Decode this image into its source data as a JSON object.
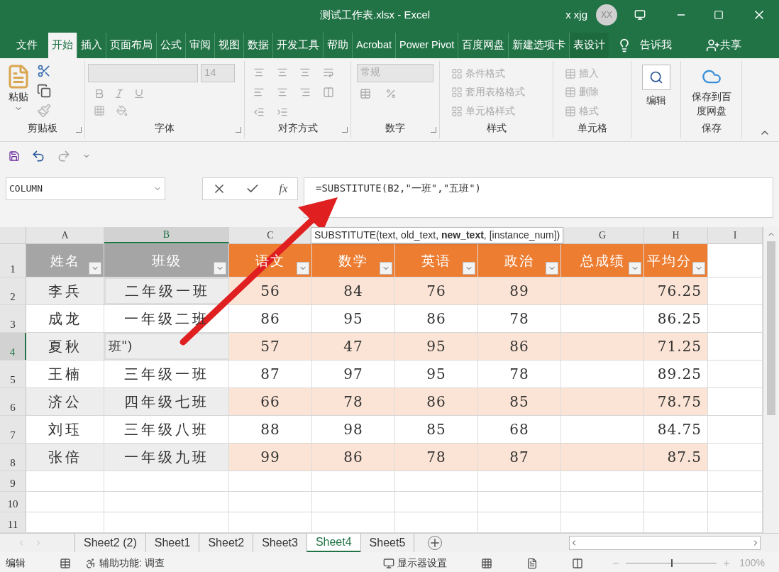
{
  "window": {
    "title": "测试工作表.xlsx  -  Excel",
    "user": "x xjg",
    "avatar": "XX"
  },
  "tabs": [
    {
      "label": "文件",
      "selected": false
    },
    {
      "label": "开始",
      "selected": true
    },
    {
      "label": "插入",
      "selected": false
    },
    {
      "label": "页面布局",
      "selected": false
    },
    {
      "label": "公式",
      "selected": false
    },
    {
      "label": "审阅",
      "selected": false
    },
    {
      "label": "视图",
      "selected": false
    },
    {
      "label": "数据",
      "selected": false
    },
    {
      "label": "开发工具",
      "selected": false
    },
    {
      "label": "帮助",
      "selected": false
    },
    {
      "label": "Acrobat",
      "selected": false
    },
    {
      "label": "Power Pivot",
      "selected": false
    },
    {
      "label": "百度网盘",
      "selected": false
    },
    {
      "label": "新建选项卡",
      "selected": false
    },
    {
      "label": "表设计",
      "selected": false
    }
  ],
  "tell_me": "告诉我",
  "share": "共享",
  "ribbon": {
    "clipboard": {
      "label": "剪贴板",
      "paste": "粘贴"
    },
    "font": {
      "label": "字体",
      "size": "14"
    },
    "alignment": {
      "label": "对齐方式"
    },
    "number": {
      "label": "数字",
      "format": "常规"
    },
    "styles": {
      "label": "样式",
      "items": [
        {
          "label": "条件格式",
          "disabled": true
        },
        {
          "label": "套用表格格式",
          "disabled": true
        },
        {
          "label": "单元格样式",
          "disabled": true
        }
      ]
    },
    "cells": {
      "label": "单元格",
      "items": [
        {
          "label": "插入",
          "disabled": true
        },
        {
          "label": "删除",
          "disabled": true
        },
        {
          "label": "格式",
          "disabled": true
        }
      ]
    },
    "editing": {
      "label": "编辑"
    },
    "save": {
      "button": "保存到百度网盘",
      "label": "保存"
    }
  },
  "name_box": "COLUMN",
  "formula": "=SUBSTITUTE(B2,\"一班\",\"五班\")",
  "tooltip": "SUBSTITUTE(text, old_text, **new_text**, [instance_num])",
  "function_button": "fx",
  "columns": [
    {
      "label": "A",
      "selected": false
    },
    {
      "label": "B",
      "selected": true
    },
    {
      "label": "C",
      "selected": false
    },
    {
      "label": "G",
      "selected": false
    },
    {
      "label": "H",
      "selected": false
    },
    {
      "label": "I",
      "selected": false
    }
  ],
  "table_headers": [
    "姓名",
    "班级",
    "语文",
    "数学",
    "英语",
    "政治",
    "总成绩",
    "平均分"
  ],
  "rows": [
    {
      "num": "1",
      "selected": false,
      "cells": []
    },
    {
      "num": "2",
      "selected": false,
      "cells": [
        "李兵",
        "二年级一班",
        "56",
        "84",
        "76",
        "89",
        "",
        "76.25"
      ]
    },
    {
      "num": "3",
      "selected": false,
      "cells": [
        "成龙",
        "一年级二班",
        "86",
        "95",
        "86",
        "78",
        "",
        "86.25"
      ]
    },
    {
      "num": "4",
      "selected": true,
      "cells": [
        "夏秋",
        "班\")",
        "57",
        "47",
        "95",
        "86",
        "",
        "71.25"
      ]
    },
    {
      "num": "5",
      "selected": false,
      "cells": [
        "王楠",
        "三年级一班",
        "87",
        "97",
        "95",
        "78",
        "",
        "89.25"
      ]
    },
    {
      "num": "6",
      "selected": false,
      "cells": [
        "济公",
        "四年级七班",
        "66",
        "78",
        "86",
        "85",
        "",
        "78.75"
      ]
    },
    {
      "num": "7",
      "selected": false,
      "cells": [
        "刘珏",
        "三年级八班",
        "88",
        "98",
        "85",
        "68",
        "",
        "84.75"
      ]
    },
    {
      "num": "8",
      "selected": false,
      "cells": [
        "张倍",
        "一年级九班",
        "99",
        "86",
        "78",
        "87",
        "",
        "87.5"
      ]
    },
    {
      "num": "9",
      "selected": false,
      "cells": []
    },
    {
      "num": "10",
      "selected": false,
      "cells": []
    },
    {
      "num": "11",
      "selected": false,
      "cells": []
    }
  ],
  "sheets": [
    {
      "label": "Sheet2 (2)",
      "selected": false
    },
    {
      "label": "Sheet1",
      "selected": false
    },
    {
      "label": "Sheet2",
      "selected": false
    },
    {
      "label": "Sheet3",
      "selected": false
    },
    {
      "label": "Sheet4",
      "selected": true
    },
    {
      "label": "Sheet5",
      "selected": false
    }
  ],
  "status": {
    "mode": "编辑",
    "accessibility": "辅助功能: 调查",
    "display": "显示器设置",
    "zoom": "100%",
    "zoom_slider": {
      "level": 0.5
    }
  }
}
